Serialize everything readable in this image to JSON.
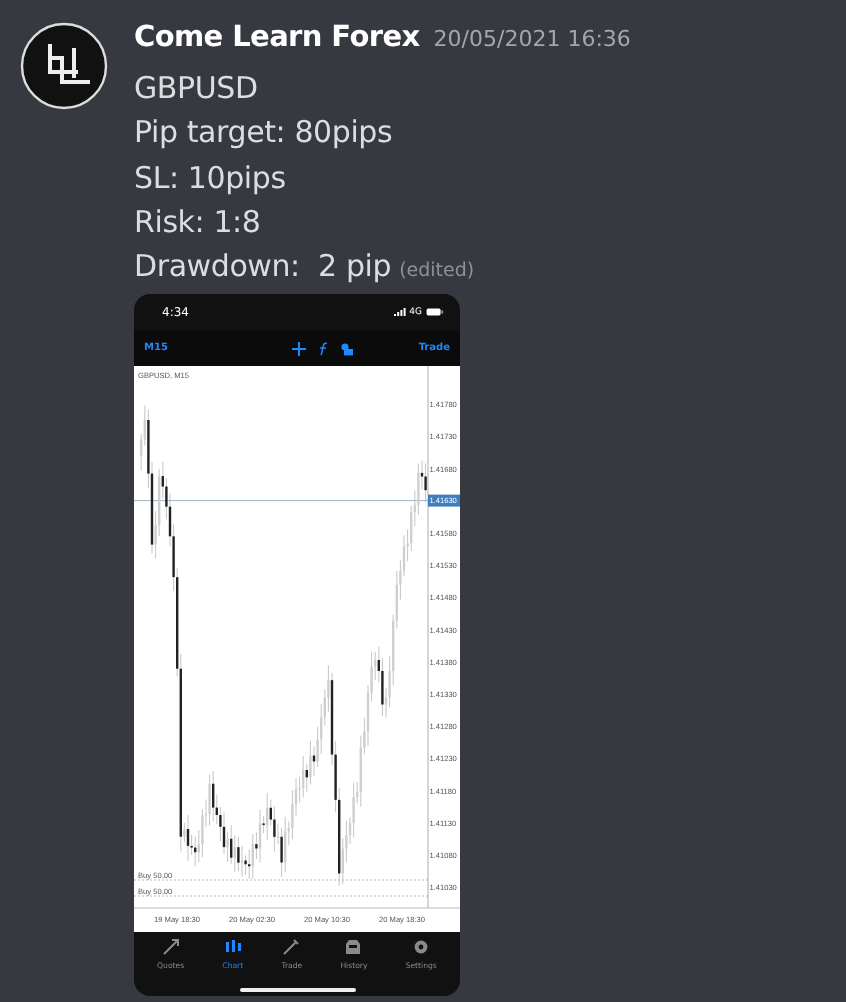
{
  "message": {
    "author": "Come Learn Forex",
    "timestamp": "20/05/2021 16:36",
    "lines": [
      "GBPUSD",
      "Pip target: 80pips",
      "SL: 10pips",
      "Risk: 1:8"
    ],
    "last_line": "Drawdown:  2 pip",
    "edited": "(edited)"
  },
  "attachment": {
    "status_time": "4:34",
    "network": "4G",
    "toolbar": {
      "timeframe": "M15",
      "trade": "Trade"
    },
    "chart": {
      "symbol": "GBPUSD, M15",
      "y_labels": [
        {
          "text": "1.41780",
          "kind": "tick"
        },
        {
          "text": "1.41730",
          "kind": "tick"
        },
        {
          "text": "1.41680",
          "kind": "tick"
        },
        {
          "text": "1.41630",
          "kind": "price"
        },
        {
          "text": "1.41580",
          "kind": "tick"
        },
        {
          "text": "1.41530",
          "kind": "tick"
        },
        {
          "text": "1.41480",
          "kind": "tick"
        },
        {
          "text": "1.41430",
          "kind": "tick"
        },
        {
          "text": "1.41380",
          "kind": "tick"
        },
        {
          "text": "1.41330",
          "kind": "tick"
        },
        {
          "text": "1.41280",
          "kind": "tick"
        },
        {
          "text": "1.41230",
          "kind": "tick"
        },
        {
          "text": "1.41180",
          "kind": "tick"
        },
        {
          "text": "1.41130",
          "kind": "tick"
        },
        {
          "text": "1.41080",
          "kind": "tick"
        },
        {
          "text": "1.41030",
          "kind": "tick"
        }
      ],
      "x_labels": [
        "19 May 18:30",
        "20 May 02:30",
        "20 May 10:30",
        "20 May 18:30"
      ],
      "orders": [
        "Buy 50.00",
        "Buy 50.00"
      ]
    },
    "tabs": [
      {
        "label": "Quotes",
        "selected": false
      },
      {
        "label": "Chart",
        "selected": true
      },
      {
        "label": "Trade",
        "selected": false
      },
      {
        "label": "History",
        "selected": false
      },
      {
        "label": "Settings",
        "selected": false
      }
    ]
  }
}
